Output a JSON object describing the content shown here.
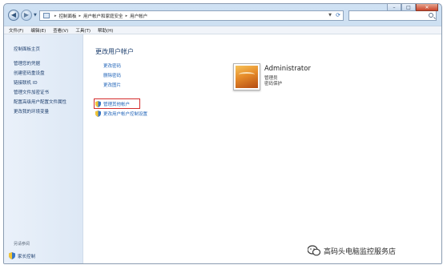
{
  "address_bar": {
    "crumbs": [
      "控制面板",
      "用户帐户和家庭安全",
      "用户帐户"
    ]
  },
  "search": {
    "placeholder": ""
  },
  "menu": [
    "文件(F)",
    "编辑(E)",
    "查看(V)",
    "工具(T)",
    "帮助(H)"
  ],
  "sidebar": {
    "home": "控制面板主页",
    "links": [
      "管理您的凭据",
      "创建密码重设盘",
      "链接联机 ID",
      "管理文件加密证书",
      "配置高级用户配置文件属性",
      "更改我的环境变量"
    ],
    "see_also": "另请参阅",
    "parental": "家长控制"
  },
  "main": {
    "title": "更改用户帐户",
    "tasks": [
      "更改密码",
      "删除密码",
      "更改图片"
    ],
    "manage_other": "管理其他帐户",
    "uac_settings": "更改用户帐户控制设置"
  },
  "account": {
    "name": "Administrator",
    "role": "管理员",
    "password_state": "密码保护"
  },
  "watermark": "高码头电脑监控服务店",
  "colors": {
    "link": "#1f63b8",
    "highlight": "#d42c2c",
    "nav_text": "#1e3f6e"
  },
  "icons": {
    "back": "back-arrow-icon",
    "forward": "forward-arrow-icon",
    "shield": "uac-shield-icon",
    "search": "search-icon",
    "refresh": "refresh-icon"
  }
}
